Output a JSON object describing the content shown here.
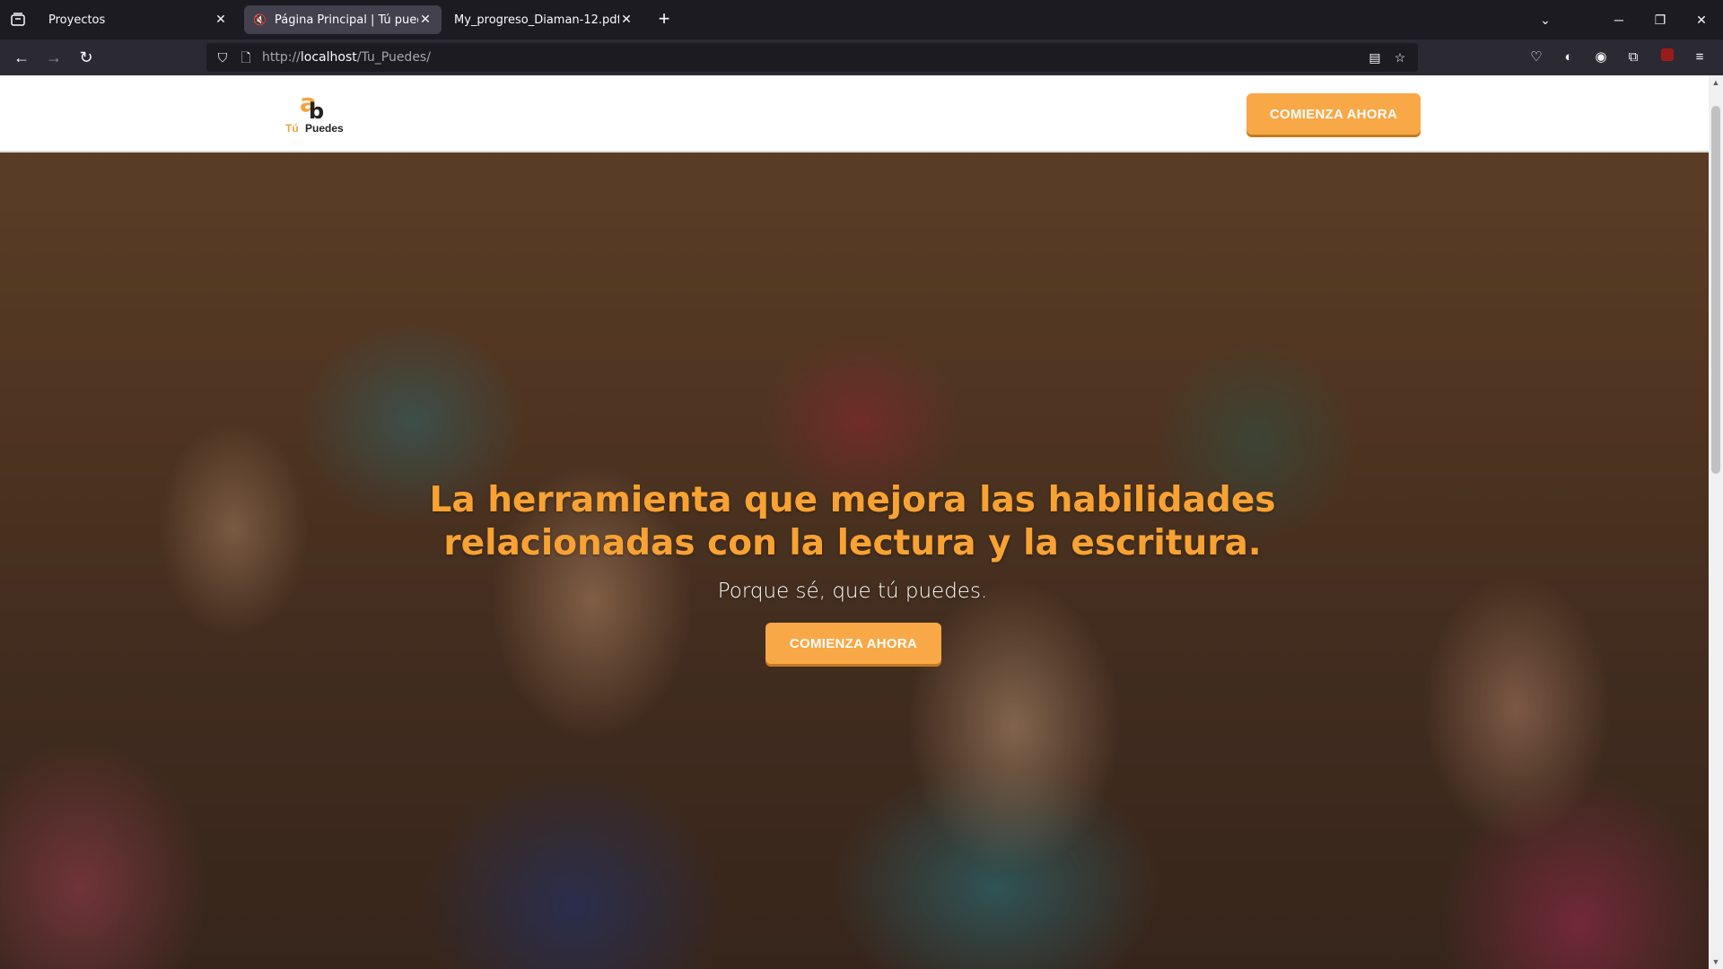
{
  "browser": {
    "tabs": [
      {
        "label": "Proyectos",
        "active": false
      },
      {
        "label": "Página Principal | Tú puedes",
        "active": true
      },
      {
        "label": "My_progreso_Diaman-12.pdf",
        "active": false
      }
    ],
    "url_prefix": "http://",
    "url_host": "localhost",
    "url_path": "/Tu_Puedes/"
  },
  "site": {
    "logo": {
      "letter_a": "a",
      "letter_b": "b",
      "tu": "Tú",
      "puedes": "Puedes"
    },
    "header_cta": "COMIENZA AHORA",
    "hero": {
      "title_line1": "La herramienta que mejora las habilidades",
      "title_line2": "relacionadas con la lectura y la escritura.",
      "subtitle": "Porque sé, que tú puedes.",
      "cta": "COMIENZA AHORA"
    }
  },
  "colors": {
    "accent": "#f8a846",
    "title": "#f8a233",
    "chrome_bg": "#1c1b22"
  }
}
